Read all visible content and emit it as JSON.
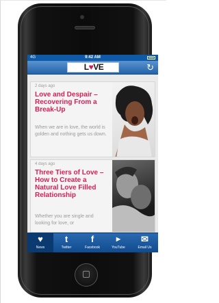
{
  "status_bar": {
    "carrier": "4G",
    "time": "9:42 AM"
  },
  "header": {
    "logo_prefix": "L",
    "logo_accent": "♥",
    "logo_suffix": "VE",
    "refresh_icon": "refresh-icon"
  },
  "articles": [
    {
      "ago": "2 days ago",
      "title": "Love and Despair – Recovering From a Break-Up",
      "excerpt": "When we are in love, the world is golden and nothing gets us down."
    },
    {
      "ago": "4 days ago",
      "title": "Three Tiers of Love – How to Create a Natural Love Filled Relationship",
      "excerpt": "Whether you are single and looking for love, or"
    }
  ],
  "tabs": [
    {
      "label": "News",
      "icon": "heart-icon"
    },
    {
      "label": "Twitter",
      "icon": "twitter-icon"
    },
    {
      "label": "Facebook",
      "icon": "facebook-icon"
    },
    {
      "label": "YouTube",
      "icon": "youtube-icon"
    },
    {
      "label": "Email Us",
      "icon": "mail-icon"
    }
  ]
}
